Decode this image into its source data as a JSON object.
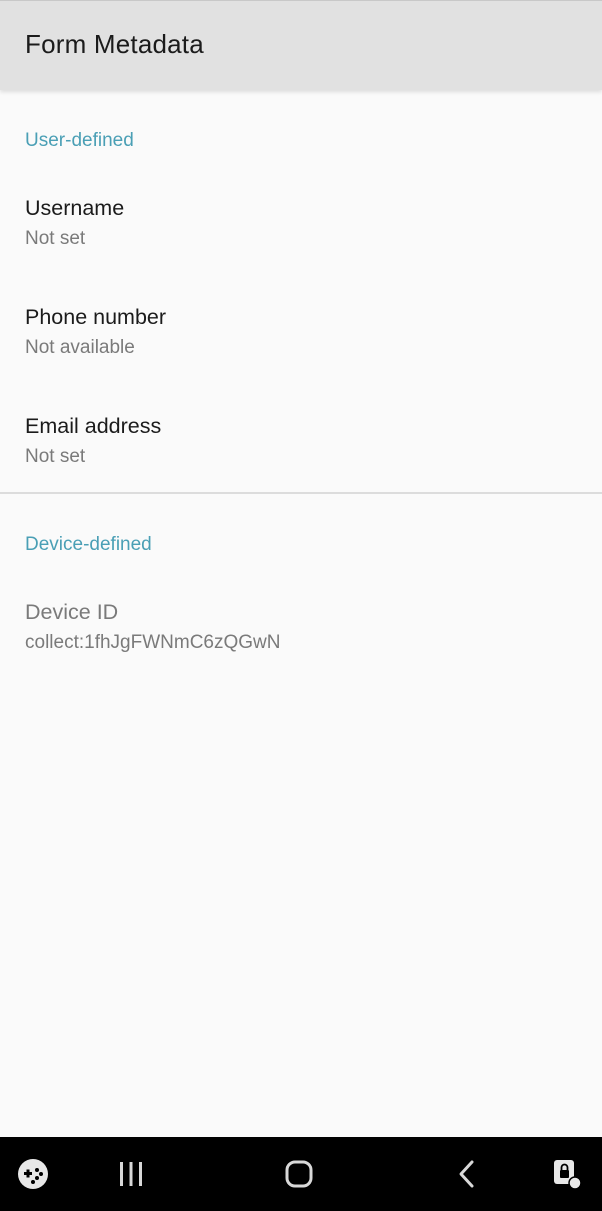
{
  "toolbar": {
    "title": "Form Metadata"
  },
  "user_section": {
    "header": "User-defined",
    "items": [
      {
        "title": "Username",
        "summary": "Not set"
      },
      {
        "title": "Phone number",
        "summary": "Not available"
      },
      {
        "title": "Email address",
        "summary": "Not set"
      }
    ]
  },
  "device_section": {
    "header": "Device-defined",
    "items": [
      {
        "title": "Device ID",
        "summary": "collect:1fhJgFWNmC6zQGwN"
      }
    ]
  },
  "navbar": {
    "buttons": [
      {
        "icon": "game-launcher-icon"
      },
      {
        "icon": "recent-apps-icon"
      },
      {
        "icon": "home-icon"
      },
      {
        "icon": "back-icon"
      },
      {
        "icon": "screen-lock-icon"
      }
    ]
  },
  "colors": {
    "accent": "#4a9fb5",
    "toolbar_bg": "#e1e1e1",
    "background": "#fafafa",
    "navbar_bg": "#000000"
  }
}
